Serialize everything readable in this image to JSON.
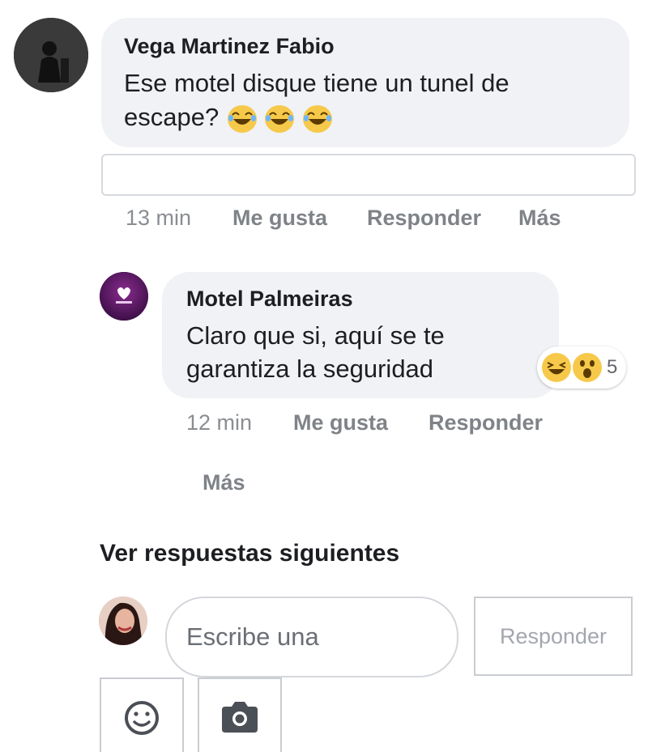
{
  "comment_1": {
    "author": "Vega Martinez Fabio",
    "text_line1": "Ese motel disque tiene un tunel de",
    "text_line2": "escape?",
    "time": "13 min",
    "like": "Me gusta",
    "reply": "Responder",
    "more": "Más"
  },
  "comment_2": {
    "author": "Motel Palmeiras",
    "text_line1": "Claro que si, aquí se te",
    "text_line2": "garantiza la seguridad",
    "time": "12 min",
    "like": "Me gusta",
    "reply": "Responder",
    "more": "Más",
    "reactions_count": "5"
  },
  "see_more_replies": "Ver respuestas siguientes",
  "composer": {
    "placeholder": "Escribe una",
    "submit": "Responder"
  },
  "colors": {
    "bubble": "#f0f2f5",
    "meta_text": "#8a8d91",
    "emoji": "#f7c94a"
  }
}
